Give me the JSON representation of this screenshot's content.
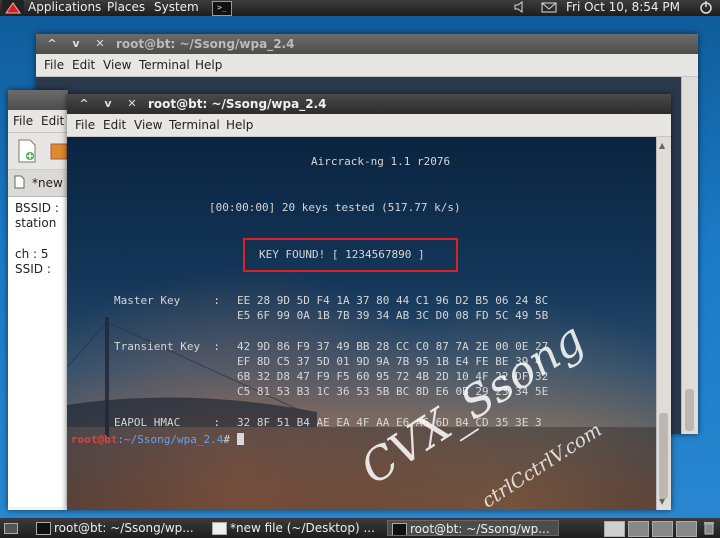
{
  "panel": {
    "applications": "Applications",
    "places": "Places",
    "system": "System",
    "terminal_launcher": ">_",
    "datetime": "Fri Oct 10,  8:54 PM"
  },
  "back_window": {
    "title": "root@bt: ~/Ssong/wpa_2.4",
    "menu": [
      "File",
      "Edit",
      "View",
      "Terminal",
      "Help"
    ]
  },
  "editor_window": {
    "menu": [
      "File",
      "Edit"
    ],
    "tab_label": "*new",
    "content_lines": [
      "BSSID :",
      "station",
      "",
      "ch : 5",
      "SSID :"
    ]
  },
  "front_window": {
    "title": "root@bt: ~/Ssong/wpa_2.4",
    "menu": [
      "File",
      "Edit",
      "View",
      "Terminal",
      "Help"
    ],
    "terminal": {
      "banner": "Aircrack-ng 1.1 r2076",
      "progress": "[00:00:00] 20 keys tested (517.77 k/s)",
      "key_found": "KEY FOUND! [ 1234567890 ]",
      "master_key_label": "Master Key     :",
      "master_key": [
        "EE 28 9D 5D F4 1A 37 80 44 C1 96 D2 B5 06 24 8C",
        "E5 6F 99 0A 1B 7B 39 34 AB 3C D0 08 FD 5C 49 5B"
      ],
      "transient_key_label": "Transient Key  :",
      "transient_key": [
        "42 9D 86 F9 37 49 BB 28 CC C0 87 7A 2E 00 0E 27",
        "EF 8D C5 37 5D 01 9D 9A 7B 95 1B E4 FE BE 39 4",
        "6B 32 D8 47 F9 F5 60 95 72 4B 2D 10 4F 22 DF 32",
        "C5 81 53 B3 1C 36 53 5B BC 8D E6 0B 29 23 34 5E"
      ],
      "eapol_label": "EAPOL HMAC     :",
      "eapol": "32 8F 51 B4 AE EA 4F AA E6 A6 6D B4 CD 35 3E 3",
      "prompt_user": "root@bt",
      "prompt_path": ":~/Ssong/wpa_2.4",
      "prompt_symbol": "#"
    }
  },
  "watermark": {
    "main": "CVX_Ssong",
    "site": "ctrlCctrlV.com"
  },
  "taskbar": {
    "tasks": [
      {
        "label": "root@bt: ~/Ssong/wp...",
        "active": false
      },
      {
        "label": "*new file (~/Desktop) ...",
        "active": false
      },
      {
        "label": "root@bt: ~/Ssong/wp...",
        "active": true
      }
    ]
  },
  "colors": {
    "key_box_border": "#e02020",
    "prompt_user": "#e04040",
    "prompt_path": "#6aa0e8"
  }
}
